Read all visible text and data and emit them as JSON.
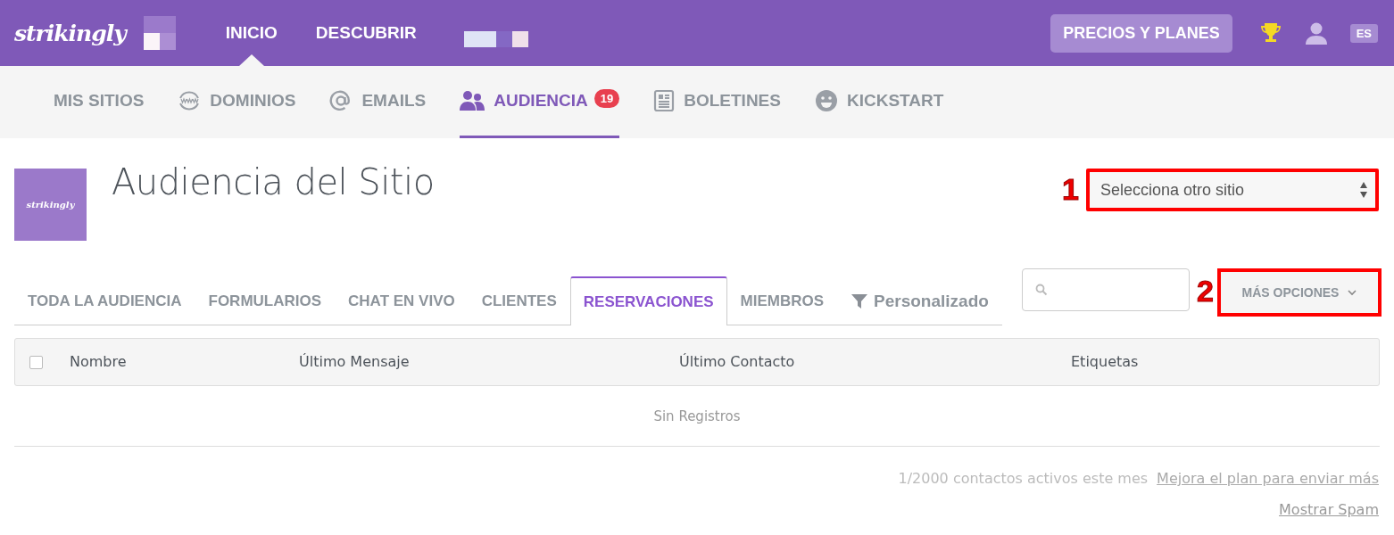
{
  "top_nav": {
    "logo": "strikingly",
    "items": [
      {
        "label": "INICIO",
        "selected": true
      },
      {
        "label": "DESCUBRIR",
        "selected": false
      }
    ],
    "pricing_button": "PRECIOS Y PLANES",
    "language": "ES"
  },
  "sub_nav": [
    {
      "label": "MIS SITIOS",
      "selected": false
    },
    {
      "label": "DOMINIOS",
      "selected": false
    },
    {
      "label": "EMAILS",
      "selected": false
    },
    {
      "label": "AUDIENCIA",
      "selected": true,
      "badge": "19"
    },
    {
      "label": "BOLETINES",
      "selected": false
    },
    {
      "label": "KICKSTART",
      "selected": false
    }
  ],
  "site_header": {
    "logo_text": "strikingly",
    "title": "Audiencia del Sitio",
    "site_select": {
      "value": "Selecciona otro sitio",
      "annotation": "1"
    }
  },
  "audience_tabs": [
    {
      "label": "TODA LA AUDIENCIA",
      "selected": false
    },
    {
      "label": "FORMULARIOS",
      "selected": false
    },
    {
      "label": "CHAT EN VIVO",
      "selected": false
    },
    {
      "label": "CLIENTES",
      "selected": false
    },
    {
      "label": "RESERVACIONES",
      "selected": true
    },
    {
      "label": "MIEMBROS",
      "selected": false
    }
  ],
  "custom_filter": "Personalizado",
  "more_options": {
    "label": "MÁS OPCIONES",
    "annotation": "2"
  },
  "table": {
    "select_all_checked": false,
    "columns": [
      "Nombre",
      "Último Mensaje",
      "Último Contacto",
      "Etiquetas"
    ],
    "empty_message": "Sin Registros"
  },
  "footer": {
    "usage": "1/2000 contactos activos este mes",
    "upgrade_link": "Mejora el plan para enviar más",
    "spam_link": "Mostrar Spam"
  }
}
